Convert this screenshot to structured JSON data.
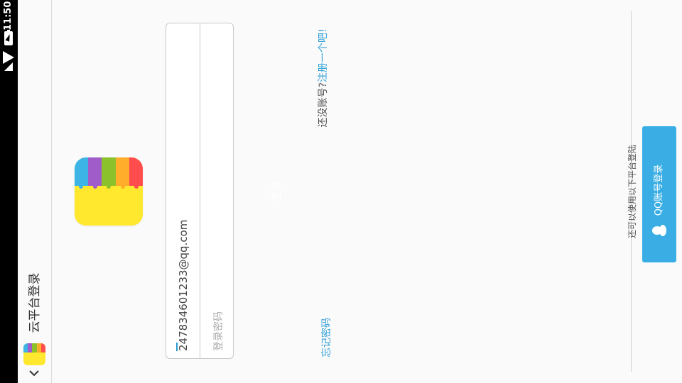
{
  "status_bar": {
    "time": "11:50"
  },
  "action_bar": {
    "title": "云平台登录",
    "back_icon": "chevron-down-icon"
  },
  "brand": {
    "stripe_colors": [
      "#3cb4e6",
      "#a05cc8",
      "#8bc12a",
      "#ffad2a",
      "#ff4d4d"
    ],
    "base_color": "#ffe82e"
  },
  "form": {
    "email_value": "247834601233@qq.com",
    "password_placeholder": "登录密码",
    "login_label": "登录"
  },
  "links": {
    "forgot_password": "忘记密码",
    "register_question": "还没账号?",
    "register_link": "注册一个吧!"
  },
  "third_party": {
    "hint": "还可以使用以下平台登陆",
    "qq_button": "QQ账号登录",
    "accent": "#3aaee4"
  }
}
